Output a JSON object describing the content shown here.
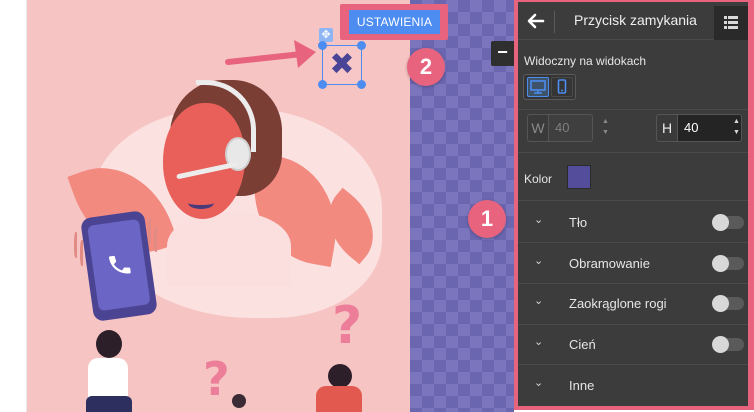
{
  "editor": {
    "settings_button_label": "USTAWIENIA",
    "close_glyph": "✖",
    "move_glyph": "✥",
    "collapse_glyph": "−",
    "badges": [
      "1",
      "2"
    ]
  },
  "panel": {
    "back_glyph": "🡐",
    "title": "Przycisk zamykania",
    "visibility_label": "Widoczny na widokach",
    "width": {
      "label": "W",
      "value": "40"
    },
    "height": {
      "label": "H",
      "value": "40"
    },
    "color_label": "Kolor",
    "color_value": "#544d9b",
    "accordions": [
      {
        "label": "Tło",
        "has_toggle": true
      },
      {
        "label": "Obramowanie",
        "has_toggle": true
      },
      {
        "label": "Zaokrąglone rogi",
        "has_toggle": true
      },
      {
        "label": "Cień",
        "has_toggle": true
      },
      {
        "label": "Inne",
        "has_toggle": false
      }
    ]
  },
  "colors": {
    "accent_blue": "#4d8cf0",
    "highlight_pink": "#e8647e",
    "panel_bg": "#3c3c3c"
  }
}
